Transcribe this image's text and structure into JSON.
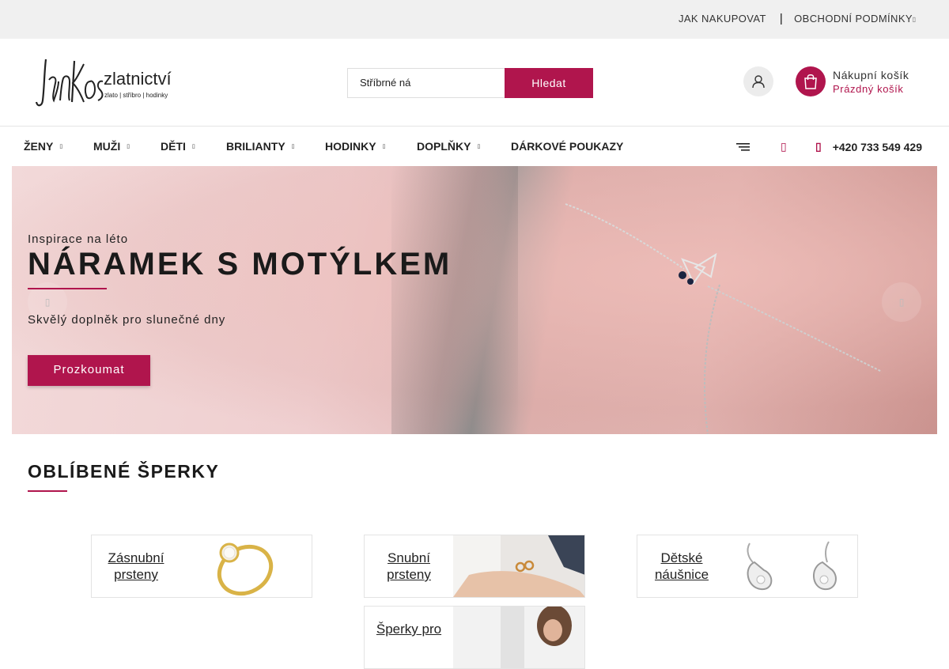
{
  "topbar": {
    "links": [
      "JAK NAKUPOVAT",
      "OBCHODNÍ PODMÍNKY"
    ],
    "separator": "|"
  },
  "header": {
    "logo_text": "JanKos",
    "logo_title": "zlatnictví",
    "logo_tagline": "zlato | stříbro | hodinky",
    "search": {
      "value": "Stříbrné ná",
      "button_label": "Hledat"
    },
    "cart": {
      "label": "Nákupní košík",
      "status": "Prázdný košík"
    }
  },
  "nav": {
    "items": [
      "ŽENY",
      "MUŽI",
      "DĚTI",
      "BRILIANTY",
      "HODINKY",
      "DOPLŇKY",
      "DÁRKOVÉ POUKAZY"
    ],
    "phone": "+420 733 549 429"
  },
  "hero": {
    "kicker": "Inspirace na léto",
    "title": "NÁRAMEK S MOTÝLKEM",
    "subtitle": "Skvělý doplněk pro slunečné dny",
    "cta": "Prozkoumat"
  },
  "section": {
    "title": "OBLÍBENÉ ŠPERKY",
    "cards": [
      {
        "label": "Zásnubní prsteny"
      },
      {
        "label": "Snubní prsteny"
      },
      {
        "label": "Dětské náušnice"
      },
      {
        "label": "Šperky pro"
      }
    ]
  },
  "colors": {
    "accent": "#b0154d",
    "topbar_bg": "#f0f0f0"
  }
}
